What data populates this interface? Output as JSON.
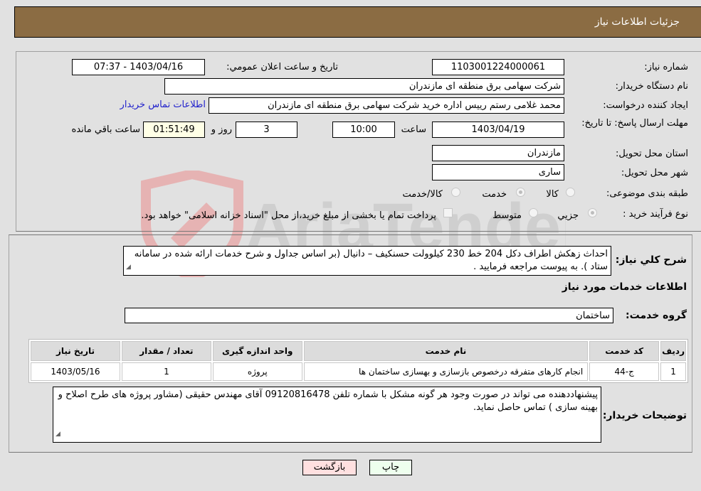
{
  "header": {
    "title": "جزئیات اطلاعات نیاز"
  },
  "fields": {
    "need_number_label": "شماره نیاز:",
    "need_number": "1103001224000061",
    "announce_label": "تاريخ و ساعت اعلان عمومي:",
    "announce_value": "1403/04/16 - 07:37",
    "buyer_org_label": "نام دستگاه خريدار:",
    "buyer_org": "شرکت سهامی برق منطقه ای مازندران",
    "creator_label": "ايجاد کننده درخواست:",
    "creator": "محمد غلامی رستم رییس اداره خرید شرکت سهامی برق منطقه ای مازندران",
    "contact_link": "اطلاعات تماس خريدار",
    "deadline_label": "مهلت ارسال پاسخ: تا تاريخ:",
    "deadline_date": "1403/04/19",
    "time_label": "ساعت",
    "deadline_time": "10:00",
    "days": "3",
    "days_label": "روز و",
    "remaining": "01:51:49",
    "remaining_label": "ساعت باقي مانده",
    "province_label": "استان محل تحویل:",
    "province": "مازندران",
    "city_label": "شهر محل تحویل:",
    "city": "ساری",
    "category_label": "طبقه بندی موضوعی:",
    "category_options": [
      "کالا",
      "خدمت",
      "کالا/خدمت"
    ],
    "category_selected": "خدمت",
    "process_label": "نوع فرآيند خريد :",
    "process_options": [
      "جزيي",
      "متوسط"
    ],
    "process_selected": "جزيي",
    "treasury_note": "پرداخت تمام يا بخشی از مبلغ خريد،از محل \"اسناد خزانه اسلامی\" خواهد بود."
  },
  "description": {
    "label": "شرح کلي نياز:",
    "text": "احداث زهکش اطراف دکل 204 خط 230 کیلوولت حسنکیف – دانیال  (بر اساس جداول و شرح خدمات ارائه شده در سامانه ستاد ). به پیوست مراجعه فرمایید ."
  },
  "services": {
    "section_title": "اطلاعات خدمات مورد نياز",
    "group_label": "گروه خدمت:",
    "group_value": "ساختمان",
    "columns": [
      "رديف",
      "کد خدمت",
      "نام خدمت",
      "واحد اندازه گيری",
      "تعداد / مقدار",
      "تاريخ نياز"
    ],
    "rows": [
      {
        "row": "1",
        "code": "ج-44",
        "name": "انجام کارهای متفرقه درخصوص بازسازی و بهسازی ساختمان ها",
        "unit": "پروژه",
        "qty": "1",
        "date": "1403/05/16"
      }
    ]
  },
  "buyer_notes": {
    "label": "توضيحات خريدار:",
    "text": "پیشنهاددهنده می تواند در صورت وجود هر گونه مشکل با شماره تلفن 09120816478 آقای مهندس حقیقی (مشاور پروژه های طرح اصلاح و بهینه سازی ) تماس حاصل نماید."
  },
  "buttons": {
    "print": "چاپ",
    "back": "بازگشت"
  },
  "colors": {
    "header": "#8b6c43",
    "print_bg": "#eeffee",
    "back_bg": "#ffe0e0",
    "remaining_bg": "#ffffe6",
    "link": "#2222cc"
  }
}
